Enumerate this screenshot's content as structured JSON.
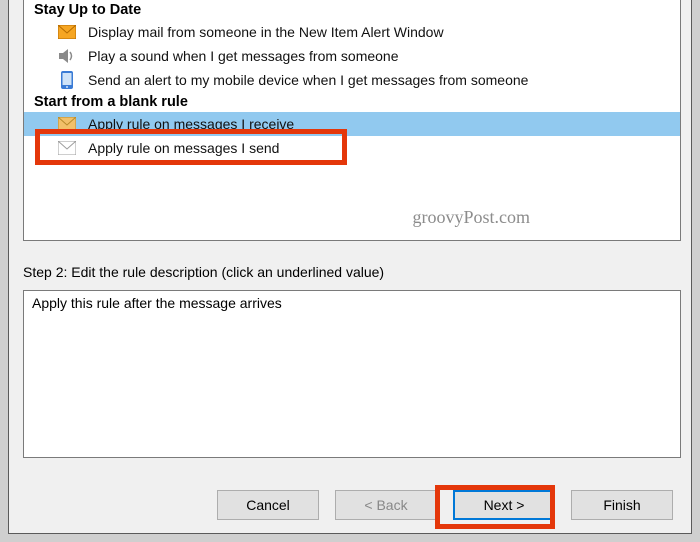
{
  "sections": {
    "stay_up_to_date": {
      "header": "Stay Up to Date",
      "items": [
        {
          "label": "Display mail from someone in the New Item Alert Window"
        },
        {
          "label": "Play a sound when I get messages from someone"
        },
        {
          "label": "Send an alert to my mobile device when I get messages from someone"
        }
      ]
    },
    "blank_rule": {
      "header": "Start from a blank rule",
      "items": [
        {
          "label": "Apply rule on messages I receive"
        },
        {
          "label": "Apply rule on messages I send"
        }
      ]
    }
  },
  "step2": {
    "label": "Step 2: Edit the rule description (click an underlined value)",
    "description": "Apply this rule after the message arrives"
  },
  "buttons": {
    "cancel": "Cancel",
    "back": "< Back",
    "next": "Next >",
    "finish": "Finish"
  },
  "watermark": "groovyPost.com"
}
